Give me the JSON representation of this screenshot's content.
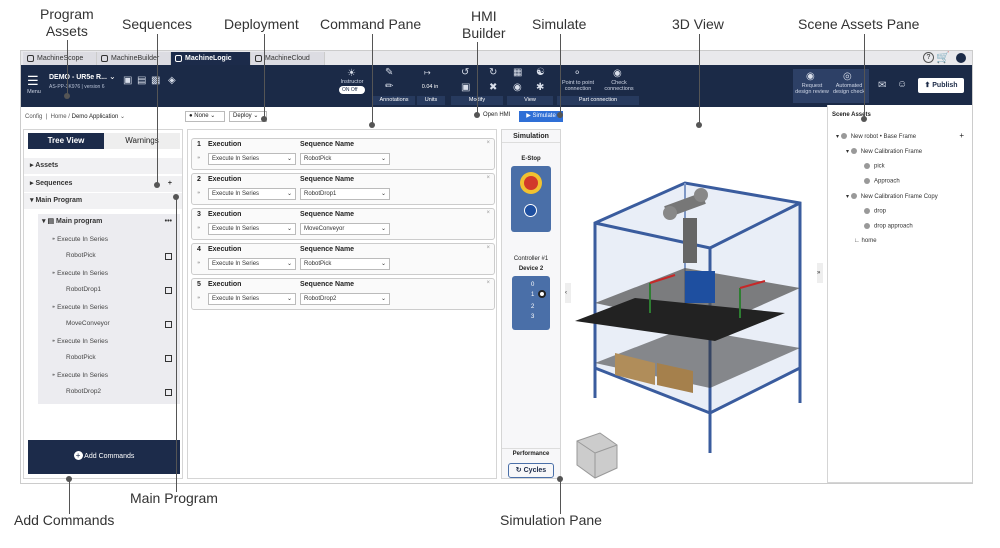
{
  "callouts": {
    "program_assets": "Program\nAssets",
    "sequences": "Sequences",
    "deployment": "Deployment",
    "command_pane": "Command Pane",
    "hmi_builder": "HMI\nBuilder",
    "simulate": "Simulate",
    "view_3d": "3D View",
    "scene_assets_pane": "Scene Assets Pane",
    "main_program": "Main Program",
    "add_commands": "Add Commands",
    "simulation_pane": "Simulation Pane"
  },
  "tabs": [
    "MachineScope",
    "MachineBuilder",
    "MachineLogic",
    "MachineCloud"
  ],
  "active_tab": 2,
  "toolbar": {
    "menu": "Menu",
    "project": "DEMO - UR5e R...",
    "project_sub": "AS-PP-3K976 | version 6",
    "instructor": "Instructor",
    "toggle_on": "ON",
    "toggle_off": "Off",
    "units_value": "0.04 in",
    "sections": [
      "Annotations",
      "Units",
      "Modify",
      "View",
      "Part connection"
    ],
    "point_to_point": "Point to point connection",
    "check_connections": "Check connections",
    "request_review": "Request design review",
    "auto_check": "Automated design check",
    "publish": "Publish"
  },
  "breadcrumb": [
    "Config",
    "Home",
    "Demo Application"
  ],
  "deploy_bar": {
    "none": "None",
    "deploy": "Deploy",
    "open_hmi": "Open HMI",
    "simulate": "Simulate"
  },
  "tree": {
    "tab_tree": "Tree View",
    "tab_warnings": "Warnings",
    "assets": "Assets",
    "sequences": "Sequences",
    "main_program": "Main Program",
    "program_name": "Main program",
    "items": [
      {
        "exec": "Execute In Series",
        "seq": "RobotPick"
      },
      {
        "exec": "Execute In Series",
        "seq": "RobotDrop1"
      },
      {
        "exec": "Execute In Series",
        "seq": "MoveConveyor"
      },
      {
        "exec": "Execute In Series",
        "seq": "RobotPick"
      },
      {
        "exec": "Execute In Series",
        "seq": "RobotDrop2"
      }
    ],
    "add_commands": "Add Commands"
  },
  "commands": {
    "exec_label": "Execution",
    "seq_label": "Sequence Name",
    "items": [
      {
        "num": "1",
        "mode": "Execute In Series",
        "seq": "RobotPick"
      },
      {
        "num": "2",
        "mode": "Execute In Series",
        "seq": "RobotDrop1"
      },
      {
        "num": "3",
        "mode": "Execute In Series",
        "seq": "MoveConveyor"
      },
      {
        "num": "4",
        "mode": "Execute In Series",
        "seq": "RobotPick"
      },
      {
        "num": "5",
        "mode": "Execute In Series",
        "seq": "RobotDrop2"
      }
    ]
  },
  "simulation": {
    "title": "Simulation",
    "estop": "E-Stop",
    "controller": "Controller #1",
    "device": "Device 2",
    "io_numbers": [
      "0",
      "1",
      "2",
      "3"
    ],
    "performance": "Performance",
    "cycles": "Cycles"
  },
  "scene": {
    "title": "Scene Assets",
    "items": [
      {
        "label": "New robot • Base Frame",
        "level": 0
      },
      {
        "label": "New Calibration Frame",
        "level": 1
      },
      {
        "label": "pick",
        "level": 2
      },
      {
        "label": "Approach",
        "level": 2
      },
      {
        "label": "New Calibration Frame Copy",
        "level": 1
      },
      {
        "label": "drop",
        "level": 2
      },
      {
        "label": "drop approach",
        "level": 2
      },
      {
        "label": "home",
        "level": 1
      }
    ]
  },
  "colors": {
    "navy": "#1b2a47",
    "blue": "#4a6fa8",
    "accent": "#2f6fd6"
  }
}
